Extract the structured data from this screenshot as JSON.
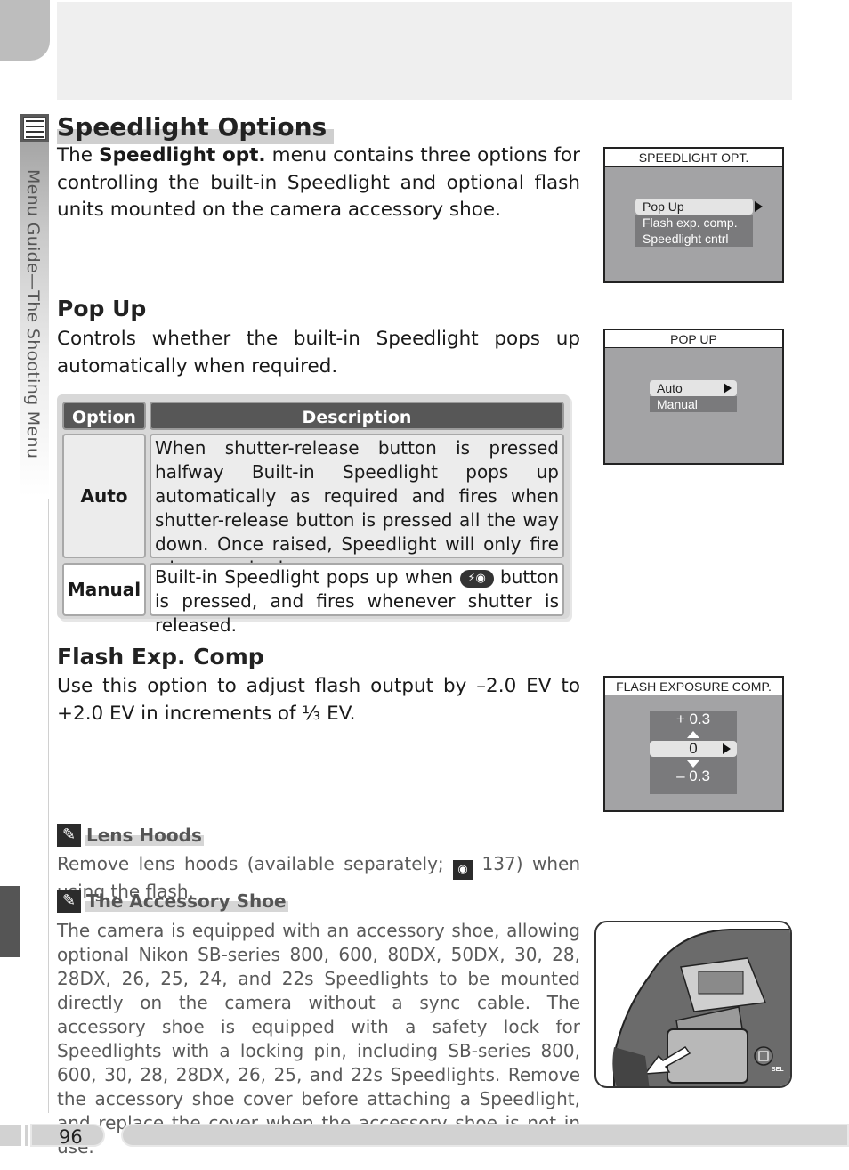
{
  "sidebar": {
    "section_label": "Menu Guide—The Shooting Menu"
  },
  "page_title": "Speedlight Options",
  "intro": {
    "prefix": "The ",
    "bold": "Speedlight opt.",
    "suffix": " menu contains three options for controlling the built-in Speedlight and optional flash units mounted on the camera accessory shoe."
  },
  "lcd_speedlight": {
    "title": "SPEEDLIGHT OPT.",
    "items": [
      "Pop Up",
      "Flash exp. comp.",
      "Speedlight cntrl"
    ],
    "selected": "Pop Up"
  },
  "popup": {
    "heading": "Pop Up",
    "text": "Controls whether the built-in Speedlight pops up automatically when required.",
    "lcd": {
      "title": "POP UP",
      "items": [
        "Auto",
        "Manual"
      ],
      "selected": "Auto"
    },
    "table": {
      "headers": [
        "Option",
        "Description"
      ],
      "rows": [
        {
          "option": "Auto",
          "description": "When shutter-release button is pressed halfway Built-in Speedlight pops up automatically as required and fires when shutter-release button is pressed all the way down.  Once raised, Speedlight will only fire when required."
        },
        {
          "option": "Manual",
          "description_prefix": "Built-in Speedlight pops up when ",
          "button_glyph": "⚡◉",
          "description_suffix": " button is pressed, and fires whenever shutter is released."
        }
      ]
    }
  },
  "flash_comp": {
    "heading": "Flash Exp. Comp",
    "text": "Use this option to adjust flash output by –2.0 EV to +2.0 EV in increments of ⅓ EV.",
    "lcd": {
      "title": "FLASH EXPOSURE COMP.",
      "upper_value": "+ 0.3",
      "current_value": "0",
      "lower_value": "– 0.3"
    }
  },
  "notes": [
    {
      "title": "Lens Hoods",
      "text_prefix": "Remove lens hoods (available separately; ",
      "ref_page": "137",
      "text_suffix": ") when using the flash."
    },
    {
      "title": "The Accessory Shoe",
      "text": "The camera is equipped with an accessory shoe, allowing optional Nikon SB-series 800, 600, 80DX, 50DX, 30, 28, 28DX, 26, 25, 24, and 22s Speedlights to be mounted directly on the camera without a sync cable.  The accessory shoe is equipped with a safety lock for Speedlights with a locking pin, including SB-series 800, 600, 30, 28, 28DX, 26, 25, and 22s Speedlights. Remove the accessory shoe cover before attaching a Speedlight, and replace the cover when the accessory shoe is not in use."
    }
  ],
  "illustration": {
    "label": "SEL"
  },
  "footer": {
    "page_number": "96"
  },
  "colors": {
    "table_header": "#575757",
    "lcd_background": "#a3a3a5",
    "lcd_item": "#7a7a7c",
    "lcd_selected": "#e4e4e4"
  }
}
